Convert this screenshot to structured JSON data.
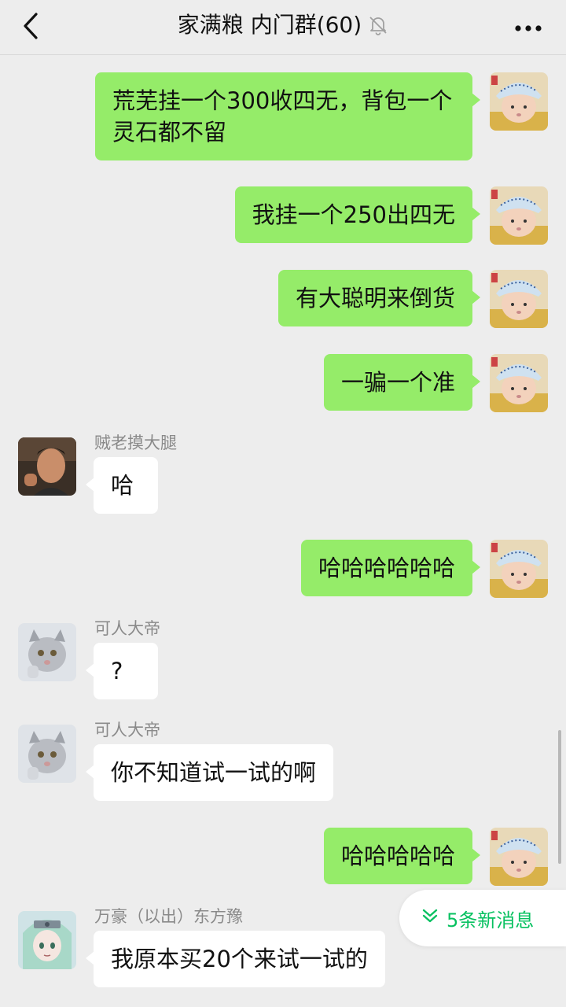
{
  "header": {
    "title": "家满粮 内门群(60)",
    "back_icon": "chevron-left-icon",
    "mute_icon": "bell-off-icon",
    "more_icon": "more-dots-icon"
  },
  "messages": [
    {
      "direction": "out",
      "text": "荒芜挂一个300收四无，背包一个灵石都不留"
    },
    {
      "direction": "out",
      "text": "我挂一个250出四无"
    },
    {
      "direction": "out",
      "text": "有大聪明来倒货"
    },
    {
      "direction": "out",
      "text": "一骗一个准"
    },
    {
      "direction": "in",
      "sender": "贼老摸大腿",
      "text": "哈"
    },
    {
      "direction": "out",
      "text": "哈哈哈哈哈哈"
    },
    {
      "direction": "in",
      "sender": "可人大帝",
      "text": "?"
    },
    {
      "direction": "in",
      "sender": "可人大帝",
      "text": "你不知道试一试的啊"
    },
    {
      "direction": "out",
      "text": "哈哈哈哈哈"
    },
    {
      "direction": "in",
      "sender": "万豪（以出）东方豫",
      "text": "我原本买20个来试一试的"
    }
  ],
  "new_messages": {
    "label": "5条新消息",
    "icon": "double-chevron-down-icon"
  },
  "colors": {
    "background": "#ededed",
    "outgoing_bubble": "#95ec69",
    "incoming_bubble": "#ffffff",
    "accent": "#07c160"
  }
}
